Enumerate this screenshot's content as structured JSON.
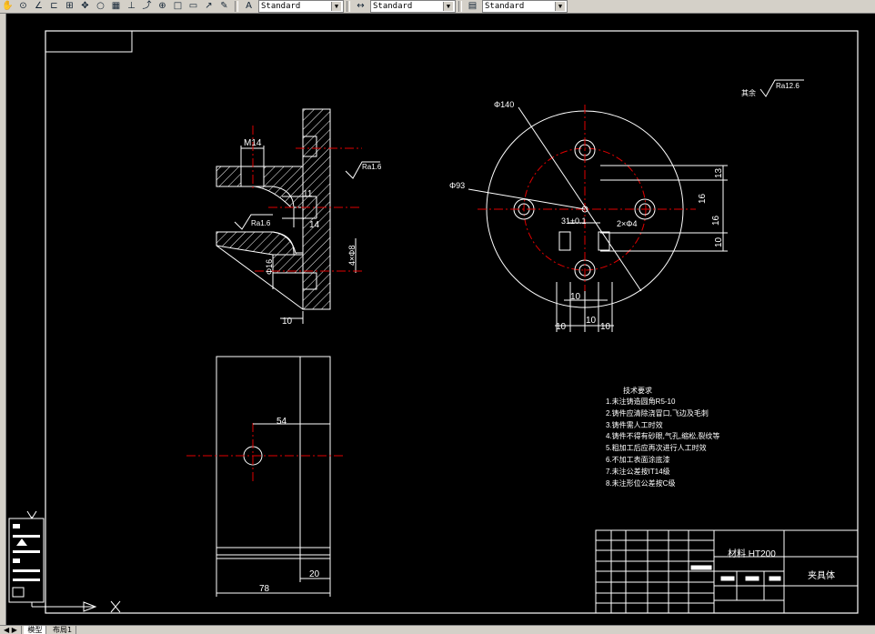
{
  "toolbar": {
    "style_dropdowns": [
      {
        "value": "Standard"
      },
      {
        "value": "Standard"
      },
      {
        "value": "Standard"
      }
    ]
  },
  "drawing": {
    "front_view": {
      "thread_label": "M14",
      "roughness_top": "Ra1.6",
      "roughness_left": "Ra1.6",
      "dim_11": "11",
      "dim_14": "14",
      "dim_4x8": "4×Φ8",
      "dim_phi16": "Φ16",
      "dim_10": "10"
    },
    "top_view": {
      "dim_phi140": "Φ140",
      "dim_phi93": "Φ93",
      "dim_31": "31±0.1",
      "dim_2xphi4": "2×Φ4",
      "dim_13": "13",
      "dim_16": "16",
      "dim_16b": "16",
      "dim_10r": "10",
      "dim_10a": "10",
      "dim_10b": "10",
      "dim_10c": "10",
      "dim_10d": "10"
    },
    "side_view": {
      "dim_54": "54",
      "dim_78": "78",
      "dim_20": "20"
    },
    "roughness_note": {
      "prefix": "其余",
      "value": "Ra12.6"
    },
    "tech_requirements": {
      "title": "技术要求",
      "items": [
        "1.未注铸造圆角R5-10",
        "2.铸件应清除浇冒口,飞边及毛刺",
        "3.铸件需人工时效",
        "4.铸件不得有砂眼,气孔,缩松,裂纹等",
        "5.粗加工后应再次进行人工时效",
        "6.不加工表面涂底漆",
        "7.未注公差按IT14级",
        "8.未注形位公差按C级"
      ]
    },
    "title_block": {
      "material": "材料 HT200",
      "part_name": "夹具体"
    }
  },
  "bottom_tabs": [
    "模型",
    "布局1"
  ]
}
